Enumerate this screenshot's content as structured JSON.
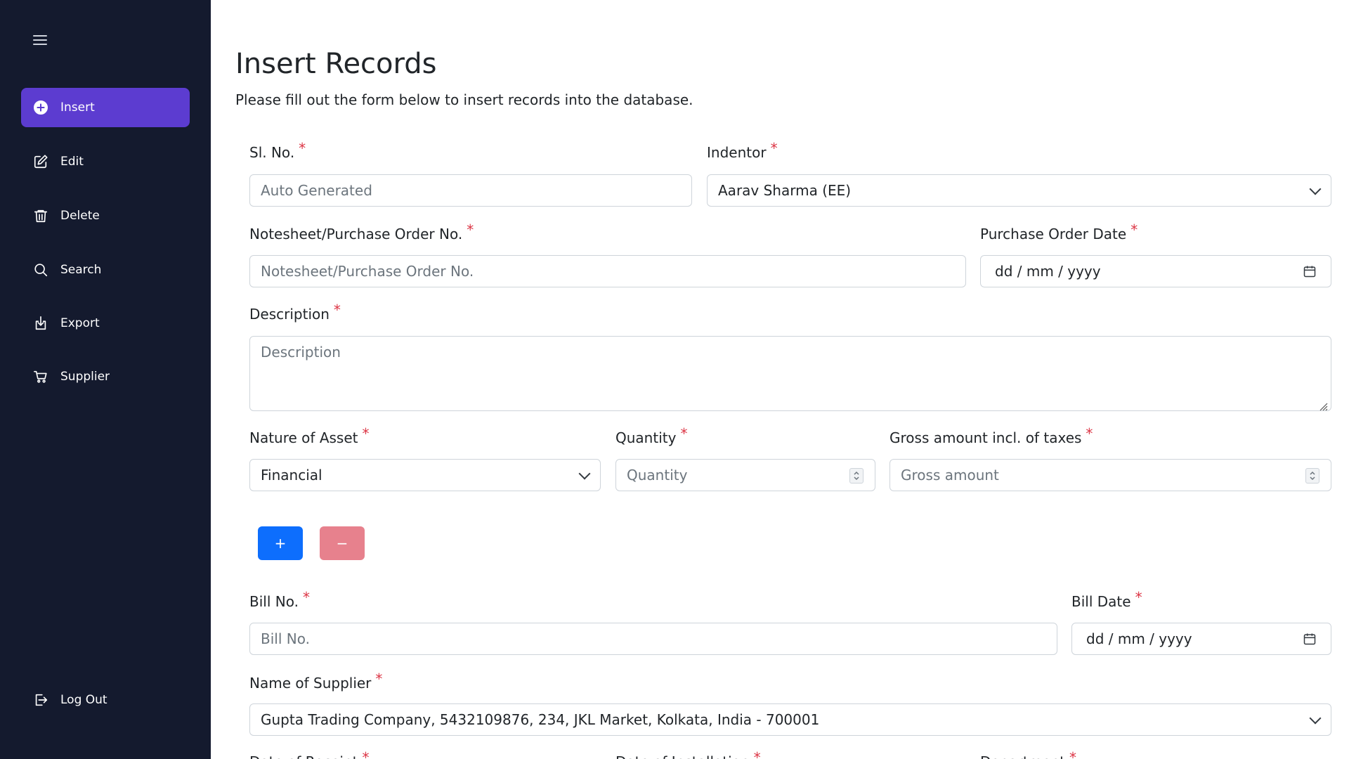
{
  "sidebar": {
    "items": [
      {
        "label": "Insert",
        "icon": "plus-circle-icon",
        "active": true
      },
      {
        "label": "Edit",
        "icon": "edit-icon"
      },
      {
        "label": "Delete",
        "icon": "trash-icon"
      },
      {
        "label": "Search",
        "icon": "search-icon"
      },
      {
        "label": "Export",
        "icon": "download-icon"
      },
      {
        "label": "Supplier",
        "icon": "cart-icon"
      }
    ],
    "logout_label": "Log Out",
    "accent_color": "#5c3cd0",
    "background_color": "#141a2e"
  },
  "header": {
    "title": "Insert Records",
    "subtitle": "Please fill out the form below to insert records into the database."
  },
  "form": {
    "sl_no": {
      "label": "Sl. No.",
      "placeholder": "Auto Generated"
    },
    "indentor": {
      "label": "Indentor",
      "value": "Aarav Sharma (EE)"
    },
    "po_no": {
      "label": "Notesheet/Purchase Order No.",
      "placeholder": "Notesheet/Purchase Order No."
    },
    "po_date": {
      "label": "Purchase Order Date",
      "placeholder": "dd / mm / yyyy"
    },
    "description": {
      "label": "Description",
      "placeholder": "Description"
    },
    "nature_of_asset": {
      "label": "Nature of Asset",
      "value": "Financial"
    },
    "quantity": {
      "label": "Quantity",
      "placeholder": "Quantity"
    },
    "gross_amount": {
      "label": "Gross amount incl. of taxes",
      "placeholder": "Gross amount"
    },
    "add_button": "+",
    "remove_button": "−",
    "bill_no": {
      "label": "Bill No.",
      "placeholder": "Bill No."
    },
    "bill_date": {
      "label": "Bill Date",
      "placeholder": "dd / mm / yyyy"
    },
    "supplier": {
      "label": "Name of Supplier",
      "value": "Gupta Trading Company, 5432109876, 234, JKL Market, Kolkata, India - 700001"
    },
    "date_of_receipt": {
      "label": "Date of Receipt"
    },
    "date_of_installation": {
      "label": "Date of Installation"
    },
    "department": {
      "label": "Department"
    },
    "required_mark": "*"
  }
}
